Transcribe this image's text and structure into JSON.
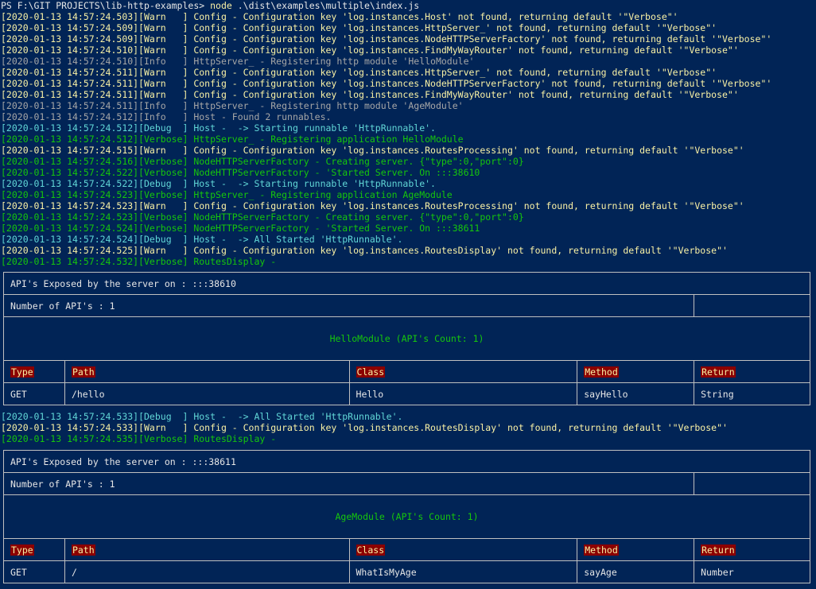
{
  "console": {
    "prompt": "PS F:\\GIT PROJECTS\\lib-http-examples> ",
    "command": "node",
    "args": " .\\dist\\examples\\multiple\\index.js",
    "log_block_1": [
      {
        "level": "warn",
        "text": "[2020-01-13 14:57:24.503][Warn   ] Config - Configuration key 'log.instances.Host' not found, returning default '\"Verbose\"'"
      },
      {
        "level": "warn",
        "text": "[2020-01-13 14:57:24.509][Warn   ] Config - Configuration key 'log.instances.HttpServer_' not found, returning default '\"Verbose\"'"
      },
      {
        "level": "warn",
        "text": "[2020-01-13 14:57:24.509][Warn   ] Config - Configuration key 'log.instances.NodeHTTPServerFactory' not found, returning default '\"Verbose\"'"
      },
      {
        "level": "warn",
        "text": "[2020-01-13 14:57:24.510][Warn   ] Config - Configuration key 'log.instances.FindMyWayRouter' not found, returning default '\"Verbose\"'"
      },
      {
        "level": "info",
        "text": "[2020-01-13 14:57:24.510][Info   ] HttpServer_ - Registering http module 'HelloModule'"
      },
      {
        "level": "warn",
        "text": "[2020-01-13 14:57:24.511][Warn   ] Config - Configuration key 'log.instances.HttpServer_' not found, returning default '\"Verbose\"'"
      },
      {
        "level": "warn",
        "text": "[2020-01-13 14:57:24.511][Warn   ] Config - Configuration key 'log.instances.NodeHTTPServerFactory' not found, returning default '\"Verbose\"'"
      },
      {
        "level": "warn",
        "text": "[2020-01-13 14:57:24.511][Warn   ] Config - Configuration key 'log.instances.FindMyWayRouter' not found, returning default '\"Verbose\"'"
      },
      {
        "level": "info",
        "text": "[2020-01-13 14:57:24.511][Info   ] HttpServer_ - Registering http module 'AgeModule'"
      },
      {
        "level": "info",
        "text": "[2020-01-13 14:57:24.512][Info   ] Host - Found 2 runnables."
      },
      {
        "level": "debug",
        "text": "[2020-01-13 14:57:24.512][Debug  ] Host -  -> Starting runnable 'HttpRunnable'."
      },
      {
        "level": "verbose",
        "text": "[2020-01-13 14:57:24.512][Verbose] HttpServer_ - Registering application HelloModule"
      },
      {
        "level": "warn",
        "text": "[2020-01-13 14:57:24.515][Warn   ] Config - Configuration key 'log.instances.RoutesProcessing' not found, returning default '\"Verbose\"'"
      },
      {
        "level": "verbose",
        "text": "[2020-01-13 14:57:24.516][Verbose] NodeHTTPServerFactory - Creating server. {\"type\":0,\"port\":0}"
      },
      {
        "level": "verbose",
        "text": "[2020-01-13 14:57:24.522][Verbose] NodeHTTPServerFactory - 'Started Server. On :::38610"
      },
      {
        "level": "debug",
        "text": "[2020-01-13 14:57:24.522][Debug  ] Host -  -> Starting runnable 'HttpRunnable'."
      },
      {
        "level": "verbose",
        "text": "[2020-01-13 14:57:24.523][Verbose] HttpServer_ - Registering application AgeModule"
      },
      {
        "level": "warn",
        "text": "[2020-01-13 14:57:24.523][Warn   ] Config - Configuration key 'log.instances.RoutesProcessing' not found, returning default '\"Verbose\"'"
      },
      {
        "level": "verbose",
        "text": "[2020-01-13 14:57:24.523][Verbose] NodeHTTPServerFactory - Creating server. {\"type\":0,\"port\":0}"
      },
      {
        "level": "verbose",
        "text": "[2020-01-13 14:57:24.524][Verbose] NodeHTTPServerFactory - 'Started Server. On :::38611"
      },
      {
        "level": "debug",
        "text": "[2020-01-13 14:57:24.524][Debug  ] Host -  -> All Started 'HttpRunnable'."
      },
      {
        "level": "warn",
        "text": "[2020-01-13 14:57:24.525][Warn   ] Config - Configuration key 'log.instances.RoutesDisplay' not found, returning default '\"Verbose\"'"
      },
      {
        "level": "verbose",
        "text": "[2020-01-13 14:57:24.532][Verbose] RoutesDisplay -"
      }
    ],
    "log_block_2": [
      {
        "level": "debug",
        "text": "[2020-01-13 14:57:24.533][Debug  ] Host -  -> All Started 'HttpRunnable'."
      },
      {
        "level": "warn",
        "text": "[2020-01-13 14:57:24.533][Warn   ] Config - Configuration key 'log.instances.RoutesDisplay' not found, returning default '\"Verbose\"'"
      },
      {
        "level": "verbose",
        "text": "[2020-01-13 14:57:24.535][Verbose] RoutesDisplay -"
      }
    ]
  },
  "table_headers": {
    "type": "Type",
    "path": "Path",
    "class": "Class",
    "method": "Method",
    "return": "Return"
  },
  "tables": [
    {
      "exposed": "API's Exposed by the server on : :::38610",
      "count": "Number of API's : 1",
      "module": "HelloModule (API's Count: 1)",
      "row": {
        "type": "GET",
        "path": "/hello",
        "class": "Hello",
        "method": "sayHello",
        "return": "String"
      }
    },
    {
      "exposed": "API's Exposed by the server on : :::38611",
      "count": "Number of API's : 1",
      "module": "AgeModule (API's Count: 1)",
      "row": {
        "type": "GET",
        "path": "/",
        "class": "WhatIsMyAge",
        "method": "sayAge",
        "return": "Number"
      }
    }
  ],
  "colors": {
    "background": "#012456",
    "warn": "#f9f1a5",
    "info": "#a6a6a6",
    "debug": "#61d6d6",
    "verbose": "#16c60c",
    "header_bg": "#8b0000"
  }
}
